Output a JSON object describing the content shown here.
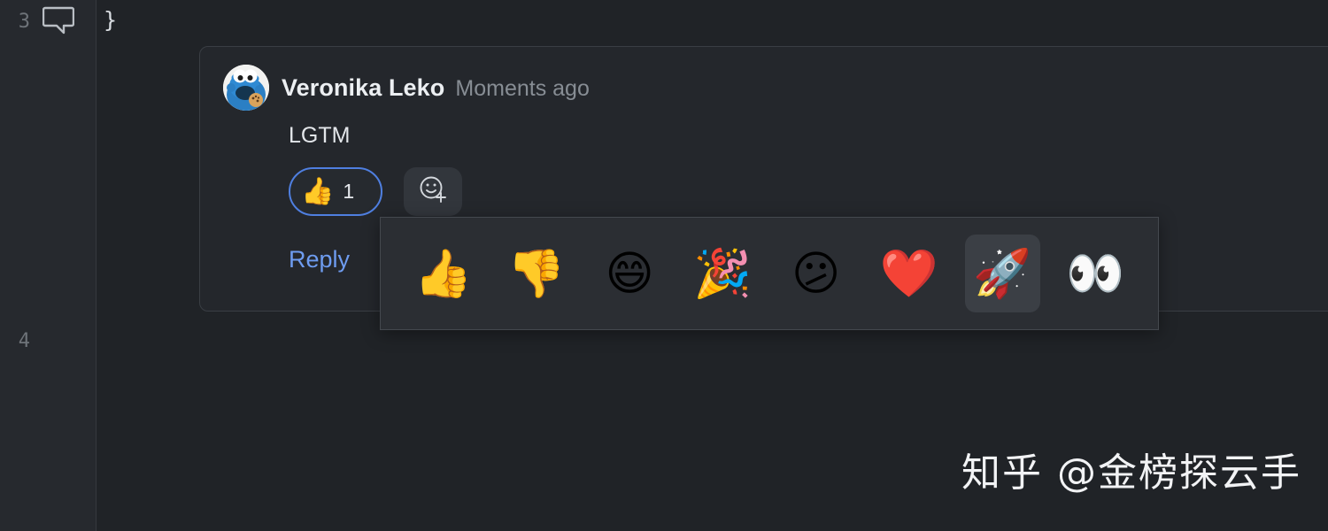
{
  "editor": {
    "gutter": {
      "lines": [
        {
          "number": "3",
          "icon": "comment-bubble-icon",
          "has_icon": true
        },
        {
          "number": "4",
          "icon": null,
          "has_icon": false
        }
      ]
    },
    "code": {
      "visible_line": "}"
    }
  },
  "comment": {
    "avatar": "cookie-monster-avatar",
    "author": "Veronika Leko",
    "timestamp": "Moments ago",
    "body": "LGTM",
    "reply_label": "Reply",
    "reactions": [
      {
        "emoji": "👍",
        "name": "thumbs-up",
        "count": "1",
        "selected": true
      }
    ],
    "add_reaction_icon": "smiley-plus-icon"
  },
  "emoji_picker": {
    "visible": true,
    "hovered_index": 6,
    "emojis": [
      {
        "char": "👍",
        "name": "thumbs-up"
      },
      {
        "char": "👎",
        "name": "thumbs-down"
      },
      {
        "char": "😄",
        "name": "grinning-smiling-eyes"
      },
      {
        "char": "🎉",
        "name": "party-popper"
      },
      {
        "char": "😕",
        "name": "confused-face"
      },
      {
        "char": "❤️",
        "name": "red-heart"
      },
      {
        "char": "🚀",
        "name": "rocket"
      },
      {
        "char": "👀",
        "name": "eyes"
      }
    ]
  },
  "watermark": {
    "text": "知乎 @金榜探云手"
  },
  "colors": {
    "background": "#202327",
    "gutter": "#26292e",
    "card_background": "#24272c",
    "card_border": "#3a3e44",
    "picker_background": "#2b2e33",
    "picker_border": "#44484e",
    "accent_selected": "#4f7fe0",
    "link": "#6e9cf0",
    "text_primary": "#e6e9ed",
    "text_muted": "#878d94",
    "hover_background": "#3b3f45"
  }
}
